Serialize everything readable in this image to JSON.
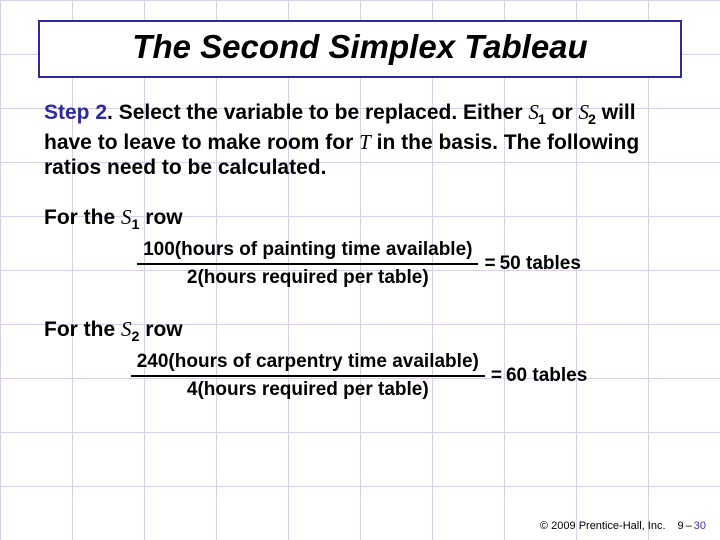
{
  "title": "The Second Simplex Tableau",
  "step_label": "Step 2",
  "step_period": ". ",
  "step_lead": "Select the variable to be replaced. Either ",
  "s1_var": "S",
  "s1_sub": "1",
  "step_mid1": " or ",
  "s2_var": "S",
  "s2_sub": "2",
  "step_mid2": " will have to leave to make room for ",
  "t_var": "T",
  "step_tail": " in the basis. The following ratios need to be calculated.",
  "row1_label_pre": "For the ",
  "row1_var": "S",
  "row1_sub": "1",
  "row1_label_post": " row",
  "row1_num": "100(hours of painting time available)",
  "row1_den": "2(hours required per table)",
  "row1_eq": "=",
  "row1_result": "50 tables",
  "row2_label_pre": "For the ",
  "row2_var": "S",
  "row2_sub": "2",
  "row2_label_post": " row",
  "row2_num": "240(hours of carpentry time available)",
  "row2_den": "4(hours required per table)",
  "row2_eq": "=",
  "row2_result": "60 tables",
  "copyright": "© 2009 Prentice-Hall, Inc.",
  "page_chapter": "9",
  "page_dash": "–",
  "page_num": "30"
}
